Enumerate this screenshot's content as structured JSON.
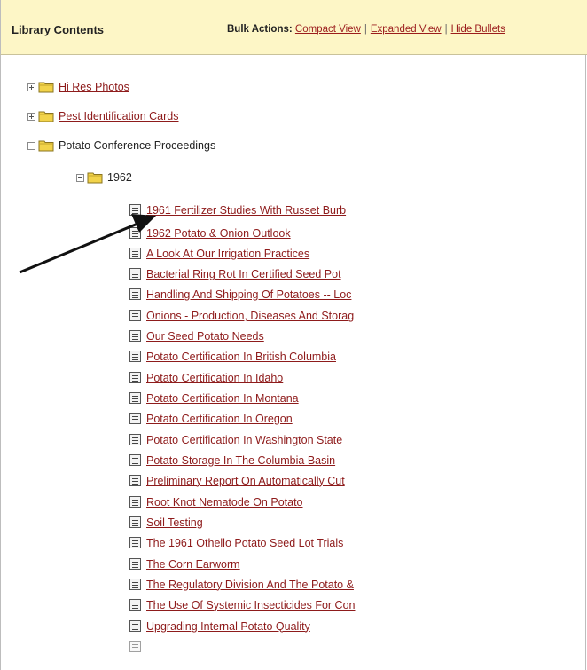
{
  "header": {
    "title": "Library Contents",
    "bulk_label": "Bulk Actions:",
    "compact_view": "Compact View",
    "expanded_view": "Expanded View",
    "hide_bullets": "Hide Bullets",
    "separator": "|"
  },
  "tree": {
    "hi_res_photos": "Hi Res Photos",
    "pest_cards": "Pest Identification Cards",
    "potato_conference": "Potato Conference Proceedings",
    "year_1962": "1962"
  },
  "documents": [
    "1961 Fertilizer Studies With Russet Burb",
    "1962 Potato & Onion Outlook",
    "A Look At Our Irrigation Practices",
    "Bacterial Ring Rot In Certified Seed Pot",
    "Handling And Shipping Of Potatoes -- Loc",
    "Onions - Production, Diseases And Storag",
    "Our Seed Potato Needs",
    "Potato Certification In British Columbia",
    "Potato Certification In Idaho",
    "Potato Certification In Montana",
    "Potato Certification In Oregon",
    "Potato Certification In Washington State",
    "Potato Storage In The Columbia Basin",
    "Preliminary Report On Automatically Cut",
    "Root Knot Nematode On Potato",
    "Soil Testing",
    "The 1961 Othello Potato Seed Lot Trials",
    "The Corn Earworm",
    "The Regulatory Division And The Potato &",
    "The Use Of Systemic Insecticides For Con",
    "Upgrading Internal Potato Quality"
  ],
  "colors": {
    "header_bg": "#fdf6c6",
    "link": "#8e1b1b",
    "folder": "#f2d34a"
  },
  "icons": {
    "folder": "folder-icon",
    "document": "document-icon",
    "expand": "expand-toggle-icon",
    "collapse": "collapse-toggle-icon",
    "arrow": "pointer-arrow"
  }
}
